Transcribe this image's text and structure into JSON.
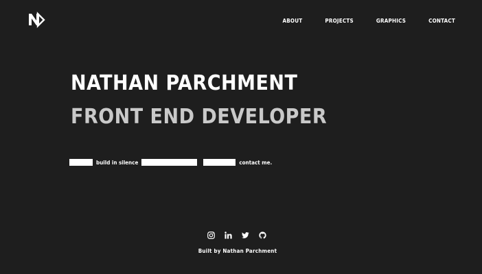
{
  "logo": {
    "icon": "np-monogram-logo"
  },
  "nav": {
    "items": [
      {
        "label": "ABOUT"
      },
      {
        "label": "PROJECTS"
      },
      {
        "label": "GRAPHICS"
      },
      {
        "label": "CONTACT"
      }
    ]
  },
  "hero": {
    "name": "NATHAN PARCHMENT",
    "role": "FRONT END DEVELOPER"
  },
  "tagline": {
    "text_1": "build in silence",
    "text_2": "contact me."
  },
  "social": {
    "icons": [
      "instagram-icon",
      "linkedin-icon",
      "twitter-icon",
      "github-icon"
    ]
  },
  "footer": {
    "credit": "Built by Nathan Parchment"
  },
  "colors": {
    "background": "#1e1e1e",
    "primary_text": "#ffffff",
    "secondary_text": "#c9c9c9"
  }
}
